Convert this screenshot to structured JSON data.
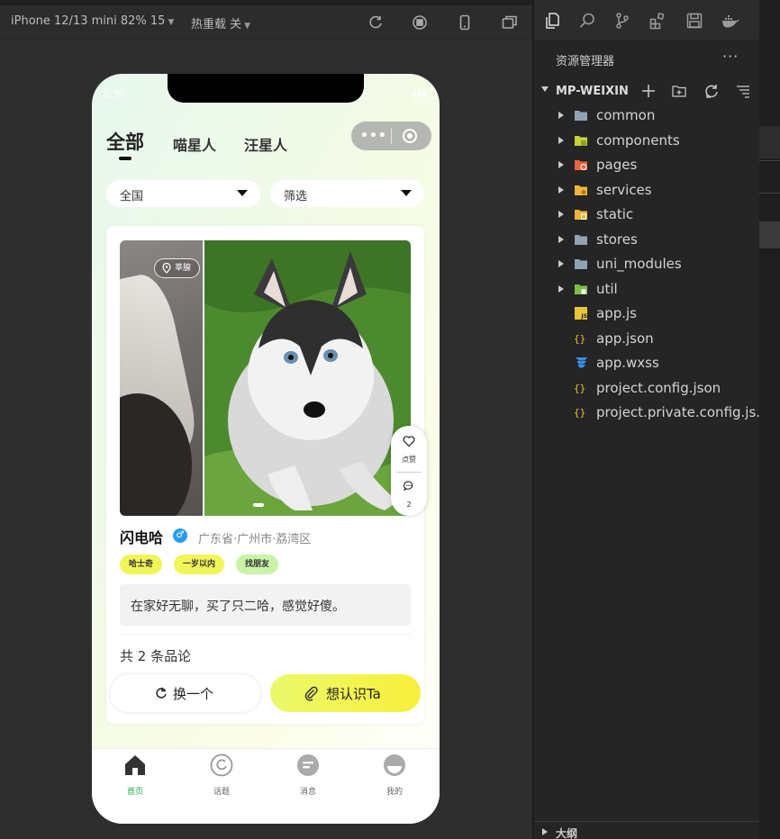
{
  "simulator": {
    "device_label": "iPhone 12/13 mini 82% 15",
    "hot_reload_label": "热重载 关"
  },
  "phone": {
    "status_time": "1:30",
    "status_right": "···· ▮▮▮",
    "tabs": [
      {
        "label": "全部",
        "active": true
      },
      {
        "label": "喵星人",
        "active": false
      },
      {
        "label": "汪星人",
        "active": false
      }
    ],
    "capsule_dots": "•••",
    "filters": [
      {
        "label": "全国"
      },
      {
        "label": "筛选"
      }
    ],
    "card": {
      "location_chip": "莘腺",
      "like_label": "点赞",
      "comment_count": "2",
      "pet_name": "闪电哈",
      "gender_symbol": "♂",
      "pet_location": "广东省·广州市·荔湾区",
      "tags": [
        {
          "label": "哈士奇",
          "color": "#f2f55a"
        },
        {
          "label": "一岁以内",
          "color": "#f2f55a"
        },
        {
          "label": "找朋友",
          "color": "#c9f3a6"
        }
      ],
      "description": "在家好无聊，买了只二哈，感觉好傻。",
      "comments_total": "共 2 条品论"
    },
    "buttons": {
      "refresh": "换一个",
      "meet": "想认识Ta"
    },
    "tabbar": [
      {
        "label": "首页",
        "icon": "home-icon",
        "active": true
      },
      {
        "label": "话题",
        "icon": "topic-icon",
        "active": false
      },
      {
        "label": "消息",
        "icon": "message-icon",
        "active": false
      },
      {
        "label": "我的",
        "icon": "profile-icon",
        "active": false
      }
    ]
  },
  "explorer": {
    "title": "资源管理器",
    "more": "···",
    "project_name": "MP-WEIXIN",
    "items": [
      {
        "label": "common",
        "type": "folder",
        "icon": "folder-icon",
        "color": "#8fa3b3"
      },
      {
        "label": "components",
        "type": "folder",
        "icon": "components-folder-icon",
        "color": "#c6d23b"
      },
      {
        "label": "pages",
        "type": "folder",
        "icon": "pages-folder-icon",
        "color": "#e8663d"
      },
      {
        "label": "services",
        "type": "folder",
        "icon": "services-folder-icon",
        "color": "#f0b43c"
      },
      {
        "label": "static",
        "type": "folder",
        "icon": "static-folder-icon",
        "color": "#f0b43c"
      },
      {
        "label": "stores",
        "type": "folder",
        "icon": "folder-icon",
        "color": "#8fa3b3"
      },
      {
        "label": "uni_modules",
        "type": "folder",
        "icon": "folder-icon",
        "color": "#8fa3b3"
      },
      {
        "label": "util",
        "type": "folder",
        "icon": "util-folder-icon",
        "color": "#7dbd4a"
      },
      {
        "label": "app.js",
        "type": "file",
        "icon": "js-file-icon",
        "color": "#e8c33c"
      },
      {
        "label": "app.json",
        "type": "file",
        "icon": "json-file-icon",
        "color": "#e8c33c"
      },
      {
        "label": "app.wxss",
        "type": "file",
        "icon": "css-file-icon",
        "color": "#3a8ee6"
      },
      {
        "label": "project.config.json",
        "type": "file",
        "icon": "json-file-icon",
        "color": "#e8c33c"
      },
      {
        "label": "project.private.config.js...",
        "type": "file",
        "icon": "json-file-icon",
        "color": "#e8c33c"
      }
    ],
    "outline_label": "大纲"
  },
  "colors": {
    "accent_green": "#2aa846",
    "meet_button": "#f5f34a",
    "ide_bg": "#252526"
  }
}
